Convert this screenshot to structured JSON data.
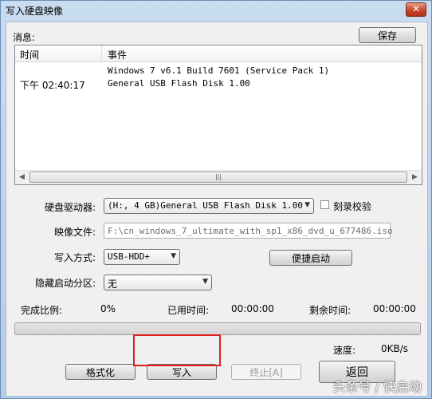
{
  "window": {
    "title": "写入硬盘映像",
    "close_glyph": "✕"
  },
  "messages": {
    "label": "消息:",
    "save_label": "保存",
    "columns": [
      "时间",
      "事件"
    ],
    "rows": [
      {
        "time": "",
        "event": "Windows 7 v6.1 Build 7601 (Service Pack 1)"
      },
      {
        "time": "下午 02:40:17",
        "event": "General USB Flash Disk  1.00"
      }
    ],
    "scroll_thumb_glyph": "|||"
  },
  "form": {
    "drive_label": "硬盘驱动器:",
    "drive_value": "(H:, 4 GB)General USB Flash Disk  1.00",
    "verify_label": "刻录校验",
    "verify_checked": false,
    "image_label": "映像文件:",
    "image_value": "F:\\cn_windows_7_ultimate_with_sp1_x86_dvd_u_677486.iso",
    "method_label": "写入方式:",
    "method_value": "USB-HDD+",
    "quick_boot_label": "便捷启动",
    "hidden_label": "隐藏启动分区:",
    "hidden_value": "无"
  },
  "status": {
    "done_label": "完成比例:",
    "done_value": "0%",
    "done_fraction": 0,
    "elapsed_label": "已用时间:",
    "elapsed_value": "00:00:00",
    "remaining_label": "剩余时间:",
    "remaining_value": "00:00:00",
    "speed_label": "速度:",
    "speed_value": "0KB/s"
  },
  "buttons": {
    "format": "格式化",
    "write": "写入",
    "stop": "终止[A]",
    "back": "返回"
  },
  "watermark": "头条号 / 快启动",
  "colors": {
    "highlight": "#e02020",
    "progress_fill": "#33c033"
  }
}
